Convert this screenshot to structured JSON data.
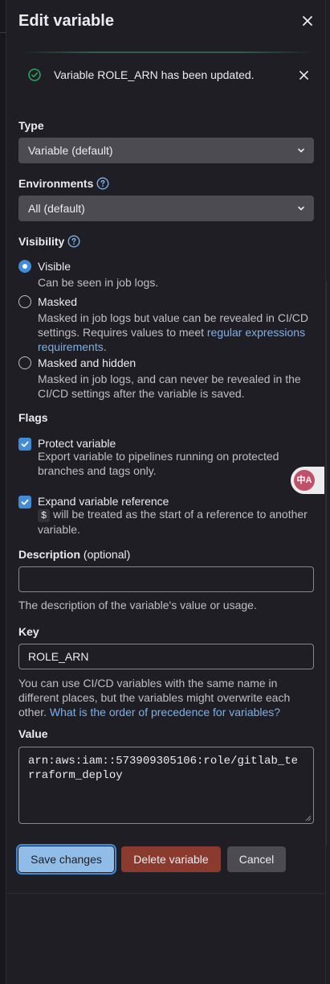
{
  "header": {
    "title": "Edit variable"
  },
  "alert": {
    "message": "Variable ROLE_ARN has been updated."
  },
  "type": {
    "label": "Type",
    "selected": "Variable (default)"
  },
  "environments": {
    "label": "Environments",
    "selected": "All (default)"
  },
  "visibility": {
    "label": "Visibility",
    "options": [
      {
        "title": "Visible",
        "desc": "Can be seen in job logs."
      },
      {
        "title": "Masked",
        "desc": "Masked in job logs but value can be revealed in CI/CD settings. Requires values to meet ",
        "link": "regular expressions requirements",
        "after": "."
      },
      {
        "title": "Masked and hidden",
        "desc": "Masked in job logs, and can never be revealed in the CI/CD settings after the variable is saved."
      }
    ]
  },
  "flags": {
    "label": "Flags",
    "protect": {
      "title": "Protect variable",
      "desc": "Export variable to pipelines running on protected branches and tags only."
    },
    "expand": {
      "title": "Expand variable reference",
      "code": "$",
      "desc": " will be treated as the start of a reference to another variable."
    }
  },
  "description": {
    "label": "Description",
    "optional": "(optional)",
    "value": "",
    "help": "The description of the variable's value or usage."
  },
  "key": {
    "label": "Key",
    "value": "ROLE_ARN",
    "help": "You can use CI/CD variables with the same name in different places, but the variables might overwrite each other. ",
    "help_link": "What is the order of precedence for variables?"
  },
  "value": {
    "label": "Value",
    "text": "arn:aws:iam::573909305106:role/gitlab_terraform_deploy"
  },
  "buttons": {
    "save": "Save changes",
    "delete": "Delete variable",
    "cancel": "Cancel"
  },
  "translate_badge": {
    "text": "中A"
  },
  "colors": {
    "accent": "#418cd8",
    "success": "#2da160",
    "danger": "#8b3a2e",
    "background": "#1f1e24"
  }
}
